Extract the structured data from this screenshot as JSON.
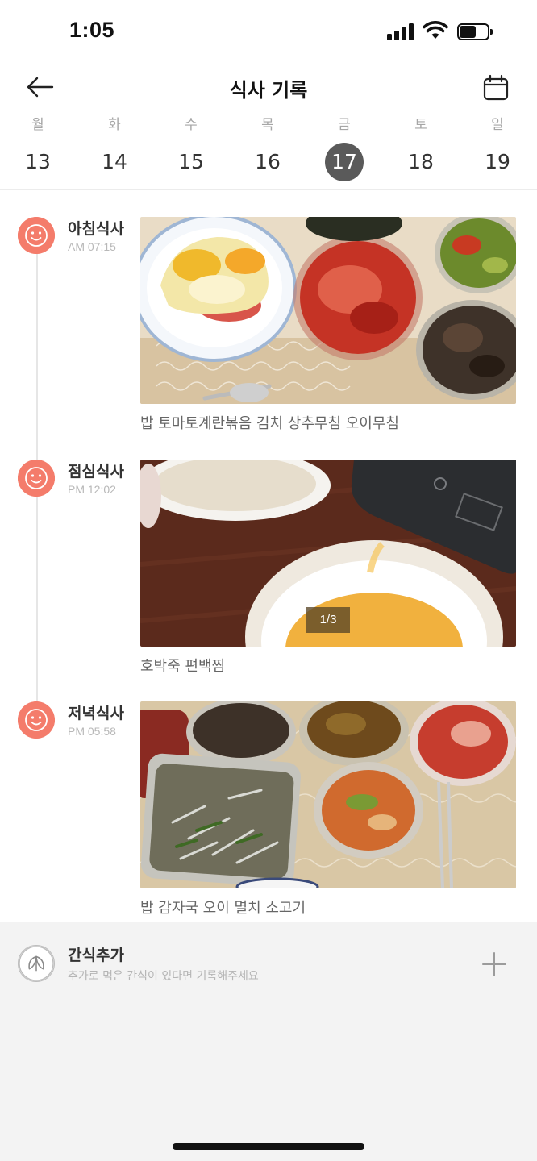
{
  "status_bar": {
    "time": "1:05",
    "battery_level": 0.6
  },
  "header": {
    "title": "식사 기록",
    "back_icon": "arrow-left-icon",
    "calendar_icon": "calendar-icon"
  },
  "week": [
    {
      "dow": "월",
      "date": "13",
      "selected": false
    },
    {
      "dow": "화",
      "date": "14",
      "selected": false
    },
    {
      "dow": "수",
      "date": "15",
      "selected": false
    },
    {
      "dow": "목",
      "date": "16",
      "selected": false
    },
    {
      "dow": "금",
      "date": "17",
      "selected": true
    },
    {
      "dow": "토",
      "date": "18",
      "selected": false
    },
    {
      "dow": "일",
      "date": "19",
      "selected": false
    }
  ],
  "meals": [
    {
      "name": "아침식사",
      "time": "AM 07:15",
      "icon": "smile-icon",
      "foods": "밥 토마토계란볶음 김치 상추무침 오이무침"
    },
    {
      "name": "점심식사",
      "time": "PM 12:02",
      "icon": "smile-icon",
      "foods": "호박죽 편백찜",
      "photo_counter": "1/3"
    },
    {
      "name": "저녁식사",
      "time": "PM 05:58",
      "icon": "smile-icon",
      "foods": "밥 감자국 오이 멸치 소고기"
    }
  ],
  "snack": {
    "title": "간식추가",
    "hint": "추가로 먹은 간식이 있다면 기록해주세요",
    "icon": "leaf-icon",
    "add_icon": "plus-icon"
  },
  "colors": {
    "accent": "#f47c6b",
    "selected_day": "#5a5a5a",
    "snack_bg": "#f3f3f3"
  }
}
